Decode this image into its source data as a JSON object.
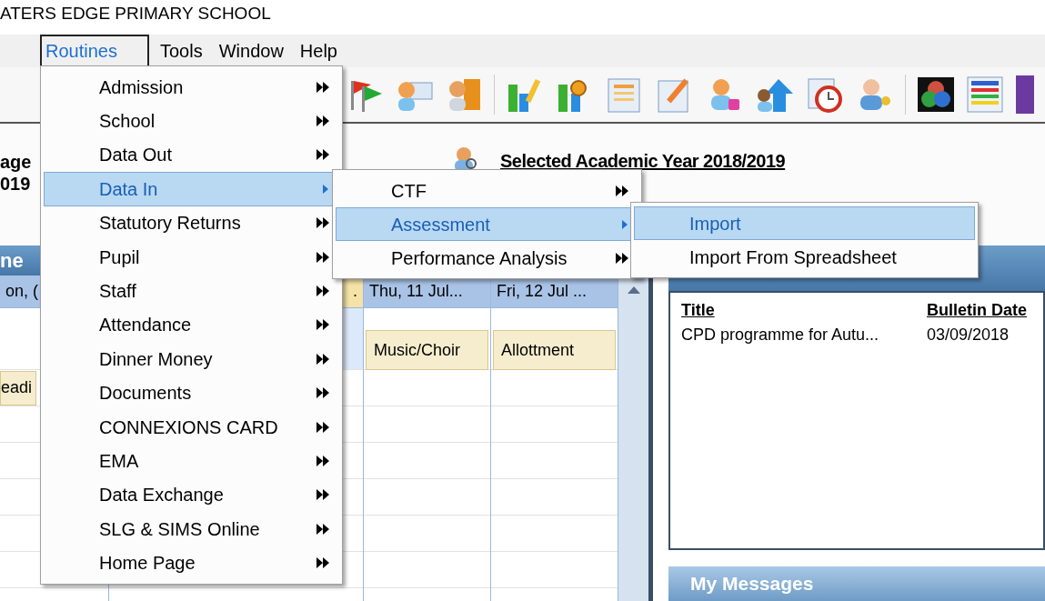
{
  "window": {
    "title": "ATERS EDGE PRIMARY SCHOOL"
  },
  "menu_bar": [
    {
      "label": "Routines",
      "selected": true
    },
    {
      "label": "Tools",
      "selected": false
    },
    {
      "label": "Window",
      "selected": false
    },
    {
      "label": "Help",
      "selected": false
    }
  ],
  "routines_menu": [
    {
      "label": "Admission",
      "selected": false,
      "submenu": true
    },
    {
      "label": "School",
      "selected": false,
      "submenu": true
    },
    {
      "label": "Data Out",
      "selected": false,
      "submenu": true
    },
    {
      "label": "Data In",
      "selected": true,
      "submenu": true
    },
    {
      "label": "Statutory Returns",
      "selected": false,
      "submenu": true
    },
    {
      "label": "Pupil",
      "selected": false,
      "submenu": true
    },
    {
      "label": "Staff",
      "selected": false,
      "submenu": true
    },
    {
      "label": "Attendance",
      "selected": false,
      "submenu": true
    },
    {
      "label": "Dinner Money",
      "selected": false,
      "submenu": true
    },
    {
      "label": "Documents",
      "selected": false,
      "submenu": true
    },
    {
      "label": "CONNEXIONS CARD",
      "selected": false,
      "submenu": true
    },
    {
      "label": "EMA",
      "selected": false,
      "submenu": true
    },
    {
      "label": "Data Exchange",
      "selected": false,
      "submenu": true
    },
    {
      "label": "SLG & SIMS Online",
      "selected": false,
      "submenu": true
    },
    {
      "label": "Home Page",
      "selected": false,
      "submenu": true
    }
  ],
  "data_in_menu": [
    {
      "label": "CTF",
      "selected": false,
      "submenu": true
    },
    {
      "label": "Assessment",
      "selected": true,
      "submenu": true
    },
    {
      "label": "Performance Analysis",
      "selected": false,
      "submenu": true
    }
  ],
  "assessment_menu": [
    {
      "label": "Import",
      "selected": true,
      "submenu": false
    },
    {
      "label": "Import From Spreadsheet",
      "selected": false,
      "submenu": false
    }
  ],
  "left_labels": [
    "age",
    "019"
  ],
  "academic_year": "Selected Academic Year 2018/2019",
  "calendar": {
    "title": "ne",
    "columns": [
      {
        "header": "on, (",
        "today": false,
        "timed": [
          "eadi"
        ]
      },
      {
        "header": ".",
        "today": true
      },
      {
        "header": "Thu, 11 Jul...",
        "today": false,
        "all_day": [
          "Music/Choir"
        ]
      },
      {
        "header": "Fri, 12 Jul ...",
        "today": false,
        "all_day": [
          "Allottment"
        ]
      }
    ]
  },
  "bulletins": {
    "columns": [
      "Title",
      "Bulletin Date"
    ],
    "rows": [
      [
        "CPD programme for Autu...",
        "03/09/2018"
      ]
    ]
  },
  "messages": {
    "title": "My Messages"
  }
}
